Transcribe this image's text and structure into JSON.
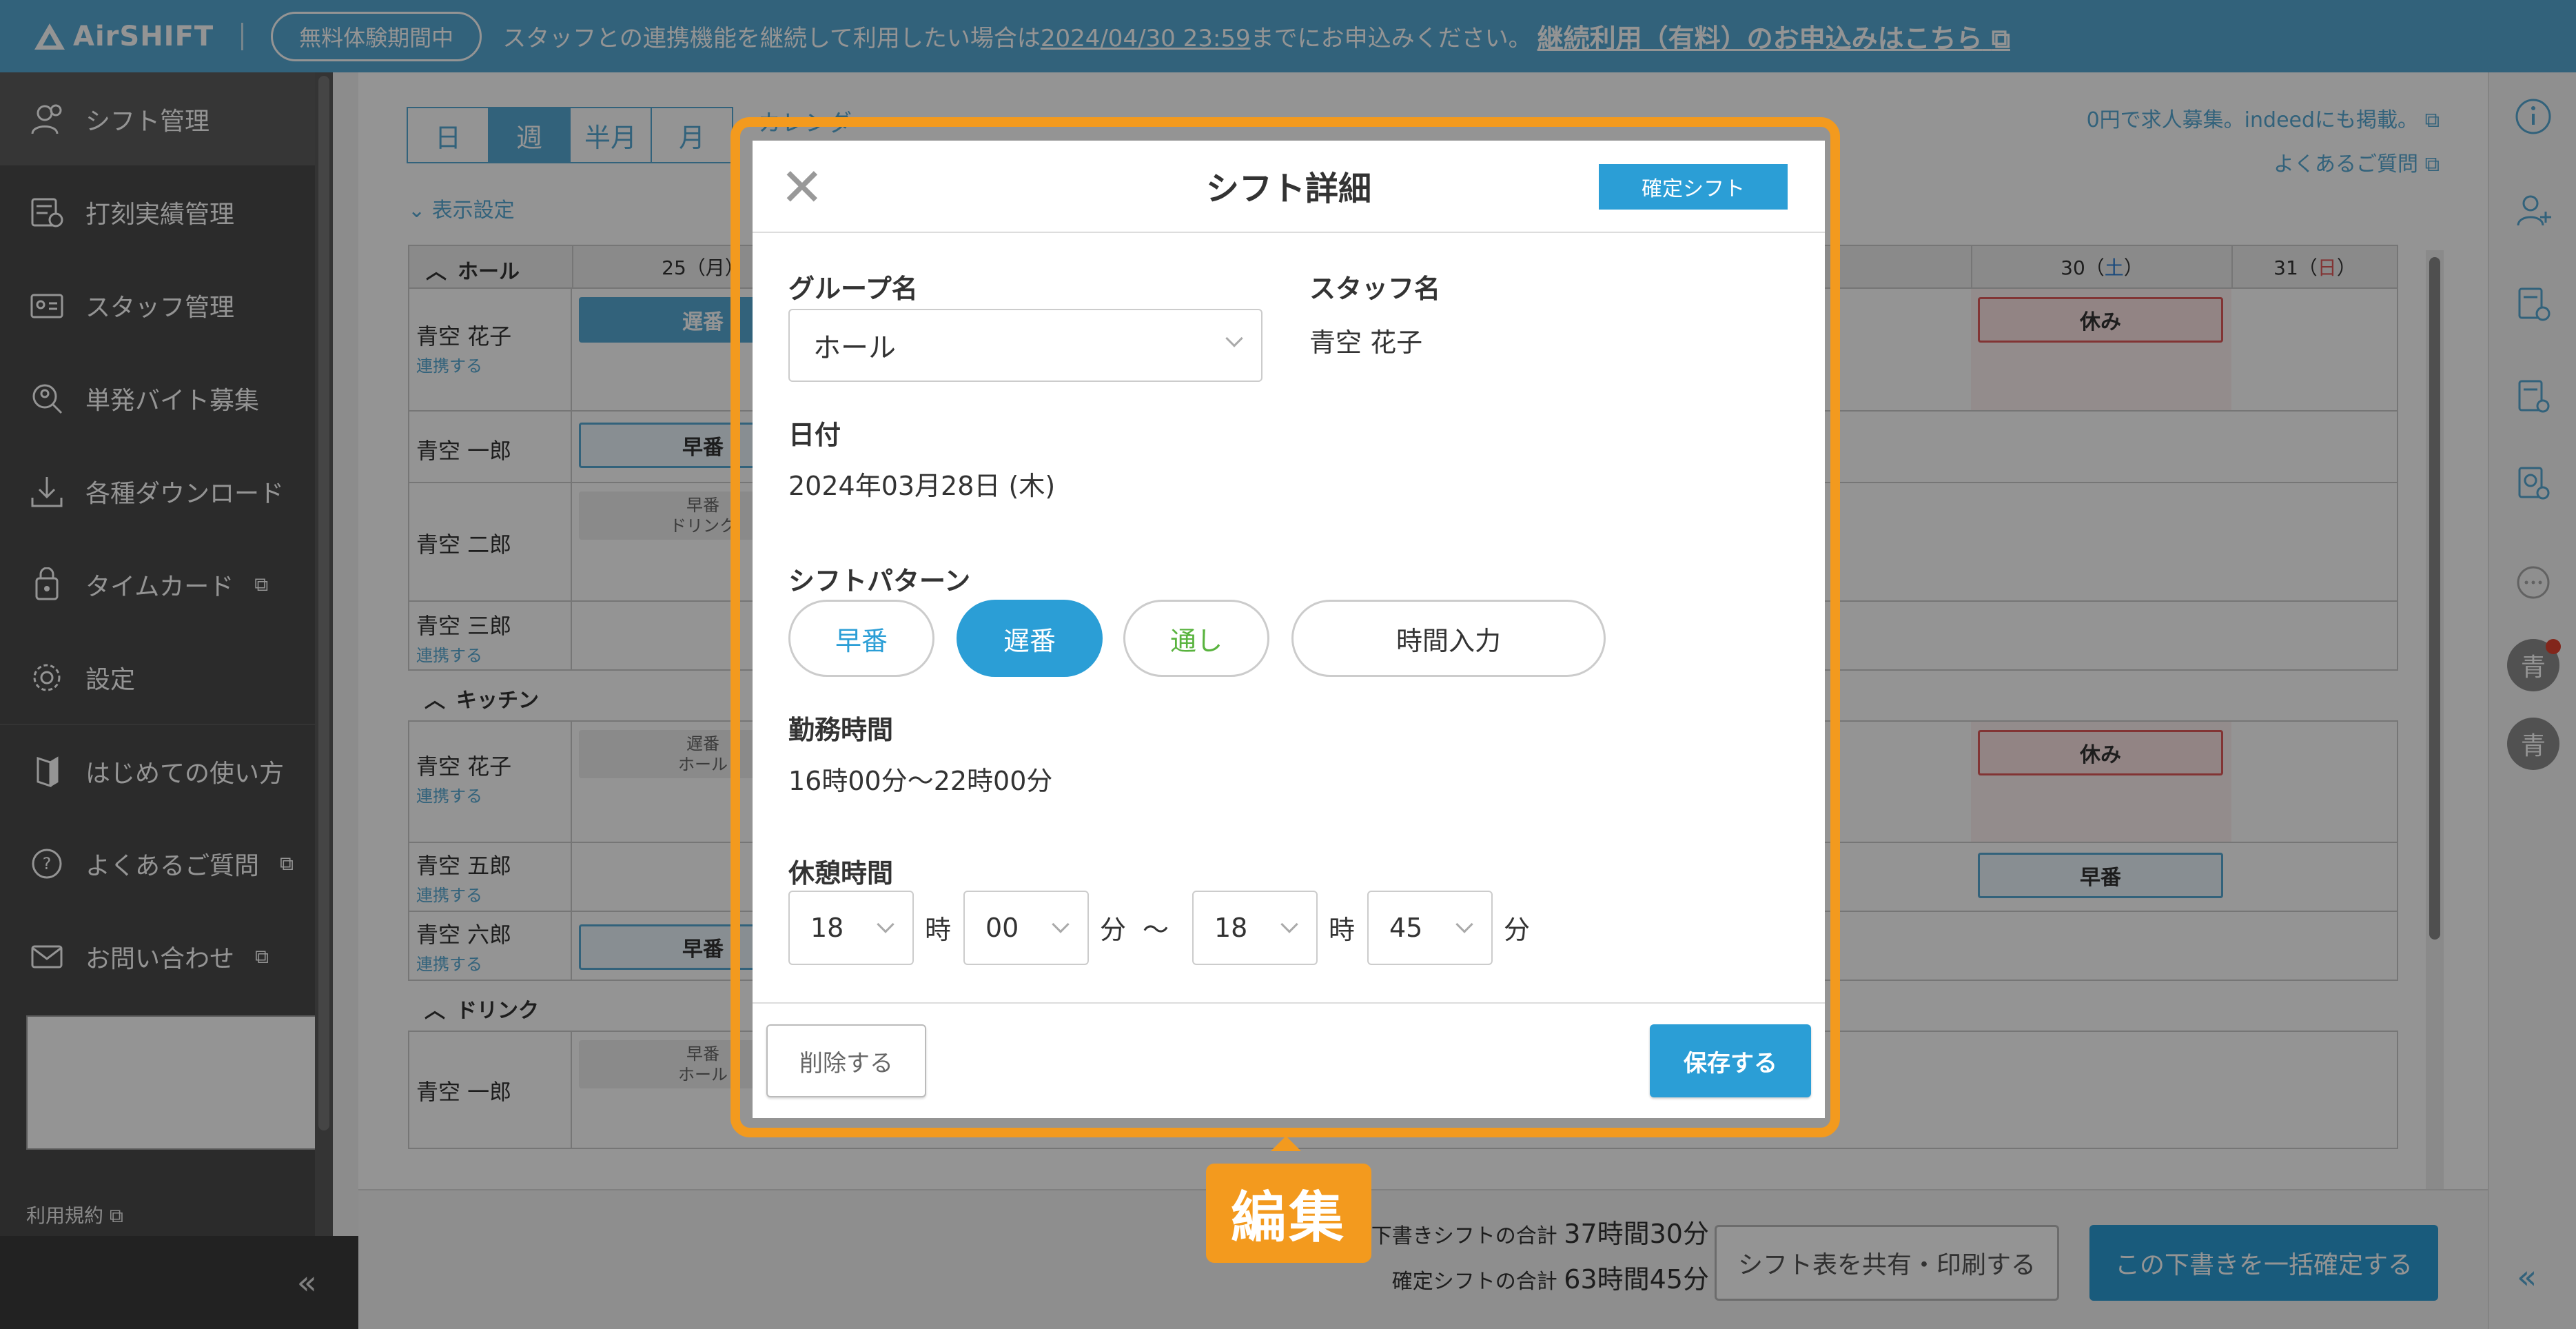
{
  "banner": {
    "logo": "AirSHIFT",
    "trial_pill": "無料体験期間中",
    "message_prefix": "スタッフとの連携機能を継続して利用したい場合は",
    "deadline": "2024/04/30 23:59",
    "message_suffix": "までにお申込みください。",
    "apply_link": "継続利用（有料）のお申込みはこちら"
  },
  "sidebar": {
    "items": [
      {
        "label": "シフト管理",
        "icon": "shift-user-icon"
      },
      {
        "label": "打刻実績管理",
        "icon": "timesheet-icon"
      },
      {
        "label": "スタッフ管理",
        "icon": "staff-card-icon"
      },
      {
        "label": "単発バイト募集",
        "icon": "search-user-icon"
      },
      {
        "label": "各種ダウンロード",
        "icon": "download-icon"
      },
      {
        "label": "タイムカード",
        "icon": "timecard-icon"
      },
      {
        "label": "設定",
        "icon": "gear-icon"
      },
      {
        "label": "はじめての使い方",
        "icon": "guide-icon"
      },
      {
        "label": "よくあるご質問",
        "icon": "question-icon"
      },
      {
        "label": "お問い合わせ",
        "icon": "mail-icon"
      }
    ],
    "terms": "利用規約",
    "collapse": "«"
  },
  "main": {
    "view_tabs": [
      "日",
      "週",
      "半月",
      "月"
    ],
    "calendar_link": "カレンダー",
    "display_settings": "表示設定",
    "right_links": [
      "0円で求人募集。indeedにも掲載。",
      "よくあるご質問"
    ],
    "grid_head": {
      "section": "ホール",
      "day25": "25（月）",
      "day30_pre": "30（",
      "day30_dow": "土",
      "day30_post": "）",
      "day31_pre": "31（",
      "day31_dow": "日",
      "day31_post": "）"
    },
    "sections": {
      "kitchen": "キッチン",
      "drink": "ドリンク"
    },
    "rows": [
      {
        "name": "青空 花子",
        "link": "連携する"
      },
      {
        "name": "青空 一郎",
        "link": ""
      },
      {
        "name": "青空 二郎",
        "link": ""
      },
      {
        "name": "青空 三郎",
        "link": "連携する"
      },
      {
        "name": "青空 花子",
        "link": "連携する"
      },
      {
        "name": "青空 五郎",
        "link": "連携する"
      },
      {
        "name": "青空 六郎",
        "link": "連携する"
      },
      {
        "name": "青空 一郎",
        "link": ""
      }
    ],
    "shift_labels": {
      "late": "遅番",
      "early": "早番",
      "rest": "休み",
      "draft_early_drink": "早番\nドリンク",
      "draft_late_hall": "遅番\nホール",
      "draft_early_hall": "早番\nホール"
    },
    "footer": {
      "draft_total_label": "下書きシフトの合計",
      "draft_total": "37時間30分",
      "confirmed_total_label": "確定シフトの合計",
      "confirmed_total": "63時間45分",
      "share_button": "シフト表を共有・印刷する",
      "confirm_all_button": "この下書きを一括確定する"
    }
  },
  "rail": {
    "avatar1": "青",
    "avatar2": "青",
    "collapse": "«"
  },
  "modal": {
    "title": "シフト詳細",
    "badge": "確定シフト",
    "group_label": "グループ名",
    "group_value": "ホール",
    "staff_label": "スタッフ名",
    "staff_value": "青空 花子",
    "date_label": "日付",
    "date_value": "2024年03月28日 (木)",
    "pattern_label": "シフトパターン",
    "patterns": [
      {
        "label": "早番",
        "color": "#2b9ed6",
        "selected": false
      },
      {
        "label": "遅番",
        "color": "#2b9ed6",
        "selected": true
      },
      {
        "label": "通し",
        "color": "#59b33e",
        "selected": false
      },
      {
        "label": "時間入力",
        "color": "#333333",
        "selected": false
      }
    ],
    "work_label": "勤務時間",
    "work_value": "16時00分〜22時00分",
    "break_label": "休憩時間",
    "break": {
      "start_hour": "18",
      "start_min": "00",
      "end_hour": "18",
      "end_min": "45",
      "hour_unit": "時",
      "min_unit": "分",
      "tilde": "〜"
    },
    "delete_button": "削除する",
    "save_button": "保存する"
  },
  "annotation": {
    "label": "編集",
    "color": "#f39a1e"
  }
}
